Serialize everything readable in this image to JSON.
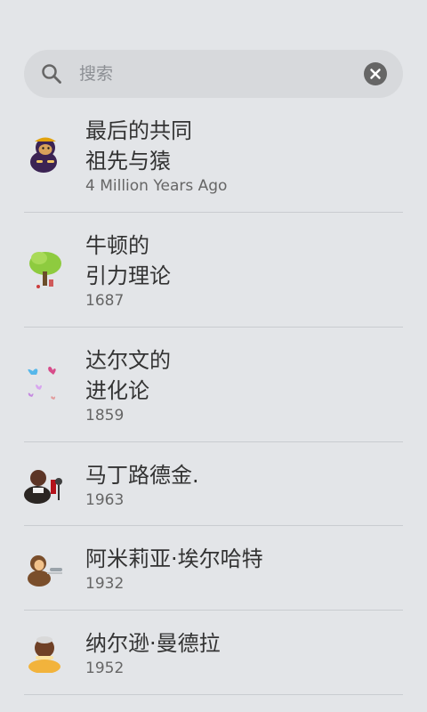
{
  "search": {
    "placeholder": "搜索",
    "search_icon": "search-icon",
    "clear_icon": "clear-icon"
  },
  "items": [
    {
      "title_lines": [
        "最后的共同",
        "祖先与猿"
      ],
      "subtitle": "4 Million Years Ago",
      "icon": "ape-icon"
    },
    {
      "title_lines": [
        "牛顿的",
        "引力理论"
      ],
      "subtitle": "1687",
      "icon": "tree-icon"
    },
    {
      "title_lines": [
        "达尔文的",
        "进化论"
      ],
      "subtitle": "1859",
      "icon": "butterflies-icon"
    },
    {
      "title_lines": [
        "马丁路德金."
      ],
      "subtitle": "1963",
      "icon": "speaker-microphone-icon"
    },
    {
      "title_lines": [
        "阿米莉亚·埃尔哈特"
      ],
      "subtitle": "1932",
      "icon": "aviator-icon"
    },
    {
      "title_lines": [
        "纳尔逊·曼德拉"
      ],
      "subtitle": "1952",
      "icon": "portrait-icon"
    }
  ]
}
